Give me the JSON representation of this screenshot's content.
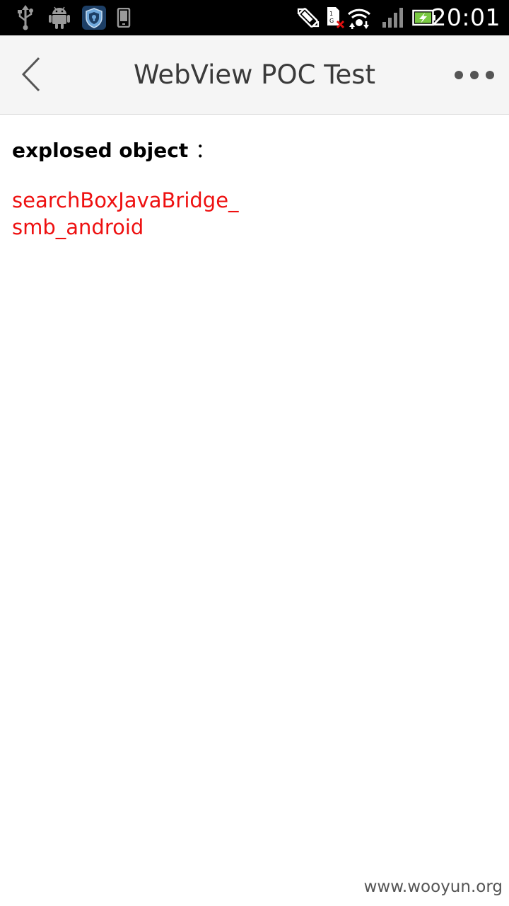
{
  "status_bar": {
    "time": "20:01",
    "left_icons": [
      "usb-icon",
      "android-debug-icon",
      "shield-app-icon",
      "phone-storage-icon"
    ],
    "right_icons": [
      "auto-rotate-icon",
      "sim-error-icon",
      "wifi-icon",
      "signal-icon",
      "battery-charging-icon"
    ]
  },
  "header": {
    "title": "WebView POC Test",
    "back_icon": "chevron-left-icon",
    "more_icon": "more-dots-icon"
  },
  "content": {
    "heading_label": "explosed object",
    "heading_colon": "：",
    "objects": [
      "searchBoxJavaBridge_",
      "smb_android"
    ],
    "object_color": "#ee1010"
  },
  "watermark": "www.wooyun.org"
}
